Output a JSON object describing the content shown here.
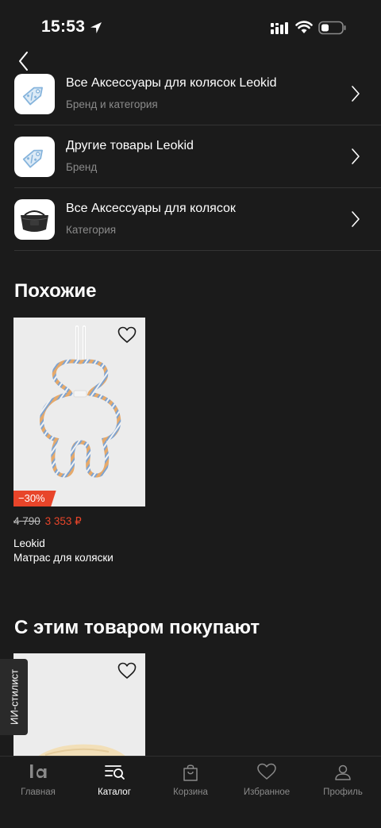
{
  "status_bar": {
    "time": "15:53"
  },
  "rows": [
    {
      "title": "Все Аксессуары для колясок Leokid",
      "subtitle": "Бренд и категория",
      "thumb": "price-tag-icon"
    },
    {
      "title": "Другие товары Leokid",
      "subtitle": "Бренд",
      "thumb": "price-tag-icon"
    },
    {
      "title": "Все Аксессуары для колясок",
      "subtitle": "Категория",
      "thumb": "stroller-bag-image"
    }
  ],
  "similar": {
    "title": "Похожие",
    "product": {
      "discount": "−30%",
      "old_price": "4 790",
      "new_price": "3 353 ₽",
      "brand": "Leokid",
      "name": "Матрас для коляски"
    }
  },
  "bought_together": {
    "title": "С этим товаром покупают"
  },
  "ai_stylist": {
    "label": "ИИ-стилист"
  },
  "tab_bar": {
    "active": "Каталог",
    "tabs": [
      {
        "label": "Главная",
        "icon": "home-la-icon"
      },
      {
        "label": "Каталог",
        "icon": "catalog-search-icon"
      },
      {
        "label": "Корзина",
        "icon": "shopping-bag-icon"
      },
      {
        "label": "Избранное",
        "icon": "heart-icon"
      },
      {
        "label": "Профиль",
        "icon": "profile-icon"
      }
    ]
  },
  "colors": {
    "background": "#1b1b1b",
    "accent_sale": "#e8452a",
    "muted_text": "#8a8a8a"
  }
}
